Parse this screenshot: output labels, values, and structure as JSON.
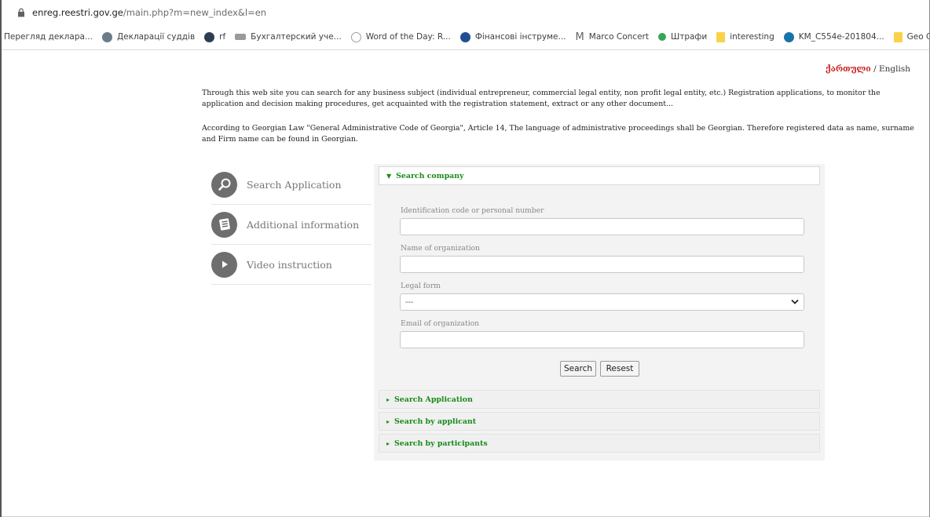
{
  "browser": {
    "url_host": "enreg.reestri.gov.ge",
    "url_rest": "/main.php?m=new_index&l=en",
    "bookmarks": [
      {
        "label": "Перегляд деклара...",
        "icon": "none",
        "color": ""
      },
      {
        "label": "Декларації суддів",
        "icon": "circle-icon",
        "color": "#6a7b8a"
      },
      {
        "label": "rf",
        "icon": "circle-icon",
        "color": "#2c3e50"
      },
      {
        "label": "Бухгалтерский уче...",
        "icon": "bookmark-icon",
        "color": "#7a7a7a"
      },
      {
        "label": "Word of the Day: R...",
        "icon": "circle-icon",
        "color": "#9aa0a6"
      },
      {
        "label": "Фінансові інструме...",
        "icon": "circle-icon",
        "color": "#1f4f8f"
      },
      {
        "label": "Marco Concert",
        "icon": "m-icon",
        "color": "#5f6368"
      },
      {
        "label": "Штрафи",
        "icon": "circle-icon",
        "color": "#34a853"
      },
      {
        "label": "interesting",
        "icon": "folder-icon",
        "color": "#f9d24a"
      },
      {
        "label": "KM_C554e-201804...",
        "icon": "circle-icon",
        "color": "#1a73a8"
      },
      {
        "label": "Geo Countries",
        "icon": "folder-icon",
        "color": "#f9d24a"
      }
    ]
  },
  "lang": {
    "georgian": "ქართული",
    "sep": " / ",
    "english": "English"
  },
  "intro": {
    "p1": "Through this web site you can search for any business subject (individual entrepreneur, commercial legal entity, non profit legal entity, etc.) Registration applications, to monitor the application and decision making procedures, get acquainted with the registration statement, extract or any other document...",
    "p2": "According to Georgian Law \"General Administrative Code of Georgia\", Article 14, The language of administrative proceedings shall be Georgian. Therefore registered data as name, surname and Firm name can be found in Georgian."
  },
  "side": {
    "items": [
      {
        "label": "Search Application",
        "icon": "magnifier-icon"
      },
      {
        "label": "Additional information",
        "icon": "document-icon"
      },
      {
        "label": "Video instruction",
        "icon": "play-icon"
      }
    ]
  },
  "form": {
    "active_section": "Search company",
    "id_label": "Identification code or personal number",
    "id_value": "",
    "name_label": "Name of organization",
    "name_value": "",
    "legal_label": "Legal form",
    "legal_value": "---",
    "email_label": "Email of organization",
    "email_value": "",
    "search_btn": "Search",
    "reset_btn": "Resest",
    "sections": [
      "Search Application",
      "Search by applicant",
      "Search by participants"
    ]
  },
  "colors": {
    "section_green": "#1a8a1a",
    "lang_red": "#c81f1f"
  }
}
